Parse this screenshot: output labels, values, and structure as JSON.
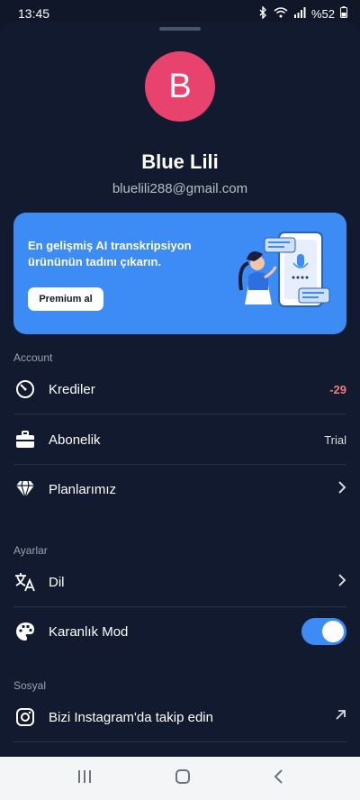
{
  "status_bar": {
    "time": "13:45",
    "battery": "%52"
  },
  "profile": {
    "avatar_letter": "B",
    "name": "Blue Lili",
    "email": "bluelili288@gmail.com"
  },
  "promo": {
    "text": "En gelişmiş AI transkripsiyon ürününün tadını çıkarın.",
    "button_label": "Premium al"
  },
  "sections": {
    "account": "Account",
    "ayarlar": "Ayarlar",
    "sosyal": "Sosyal"
  },
  "account_items": [
    {
      "label": "Krediler",
      "value": "-29",
      "icon": "timer-icon"
    },
    {
      "label": "Abonelik",
      "value": "Trial",
      "icon": "briefcase-icon"
    },
    {
      "label": "Planlarımız",
      "icon": "diamond-icon"
    }
  ],
  "settings_items": [
    {
      "label": "Dil",
      "icon": "translate-icon"
    },
    {
      "label": "Karanlık Mod",
      "icon": "palette-icon",
      "toggle_on": true
    }
  ],
  "social_items": [
    {
      "label": "Bizi Instagram'da takip edin",
      "icon": "instagram-icon"
    }
  ],
  "colors": {
    "accent": "#3d8bf5",
    "avatar": "#e8436f",
    "negative": "#f27a7a",
    "background": "#111a2e"
  }
}
